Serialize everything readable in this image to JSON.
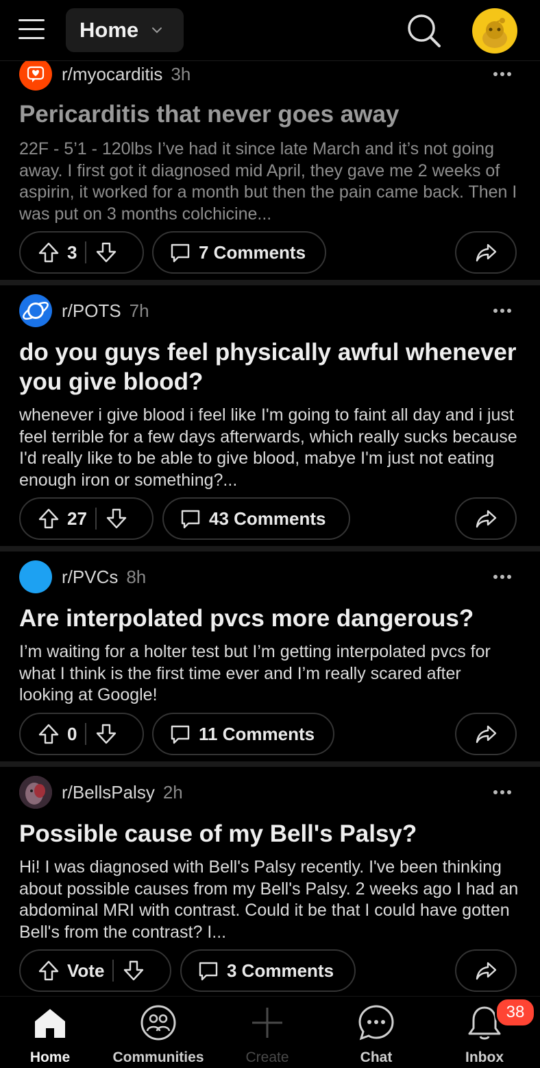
{
  "header": {
    "feed_label": "Home",
    "menu_icon": "hamburger-menu-icon",
    "search_icon": "search-icon",
    "avatar_icon": "snoo-avatar-icon"
  },
  "posts": [
    {
      "subreddit": "r/myocarditis",
      "time": "3h",
      "title": "Pericarditis that never goes away",
      "body": "22F - 5’1 - 120lbs I’ve had it since late March and it’s not going away. I first got it diagnosed mid April, they gave me 2 weeks of aspirin, it worked for a month but then the pain came back. Then I was put on 3 months colchicine...",
      "votes": "3",
      "comments": "7 Comments",
      "icon_color": "#ff4500"
    },
    {
      "subreddit": "r/POTS",
      "time": "7h",
      "title": "do you guys feel physically awful whenever you give blood?",
      "body": "whenever i give blood i feel like I'm going to faint all day and i just feel terrible for a few days afterwards, which really sucks because I'd really like to be able to give blood, mabye I'm just not eating enough iron or something?...",
      "votes": "27",
      "comments": "43 Comments",
      "icon_color": "#1a73e8"
    },
    {
      "subreddit": "r/PVCs",
      "time": "8h",
      "title": "Are interpolated pvcs more dangerous?",
      "body": "I’m waiting for a holter test but I’m getting interpolated pvcs for what I think is the first time ever and I’m really scared after looking at Google!",
      "votes": "0",
      "comments": "11 Comments",
      "icon_color": "#1da1f2"
    },
    {
      "subreddit": "r/BellsPalsy",
      "time": "2h",
      "title": "Possible cause of my Bell's Palsy?",
      "body": "Hi! I was diagnosed with Bell's Palsy recently. I've been thinking about possible causes from my Bell's Palsy. 2 weeks ago I had an abdominal MRI with contrast. Could it be that I could have gotten Bell's from the contrast? I...",
      "votes": "Vote",
      "comments": "3 Comments",
      "icon_color": "#5a3a4a"
    }
  ],
  "nav": {
    "home": "Home",
    "communities": "Communities",
    "create": "Create",
    "chat": "Chat",
    "inbox": "Inbox",
    "inbox_badge": "38"
  }
}
